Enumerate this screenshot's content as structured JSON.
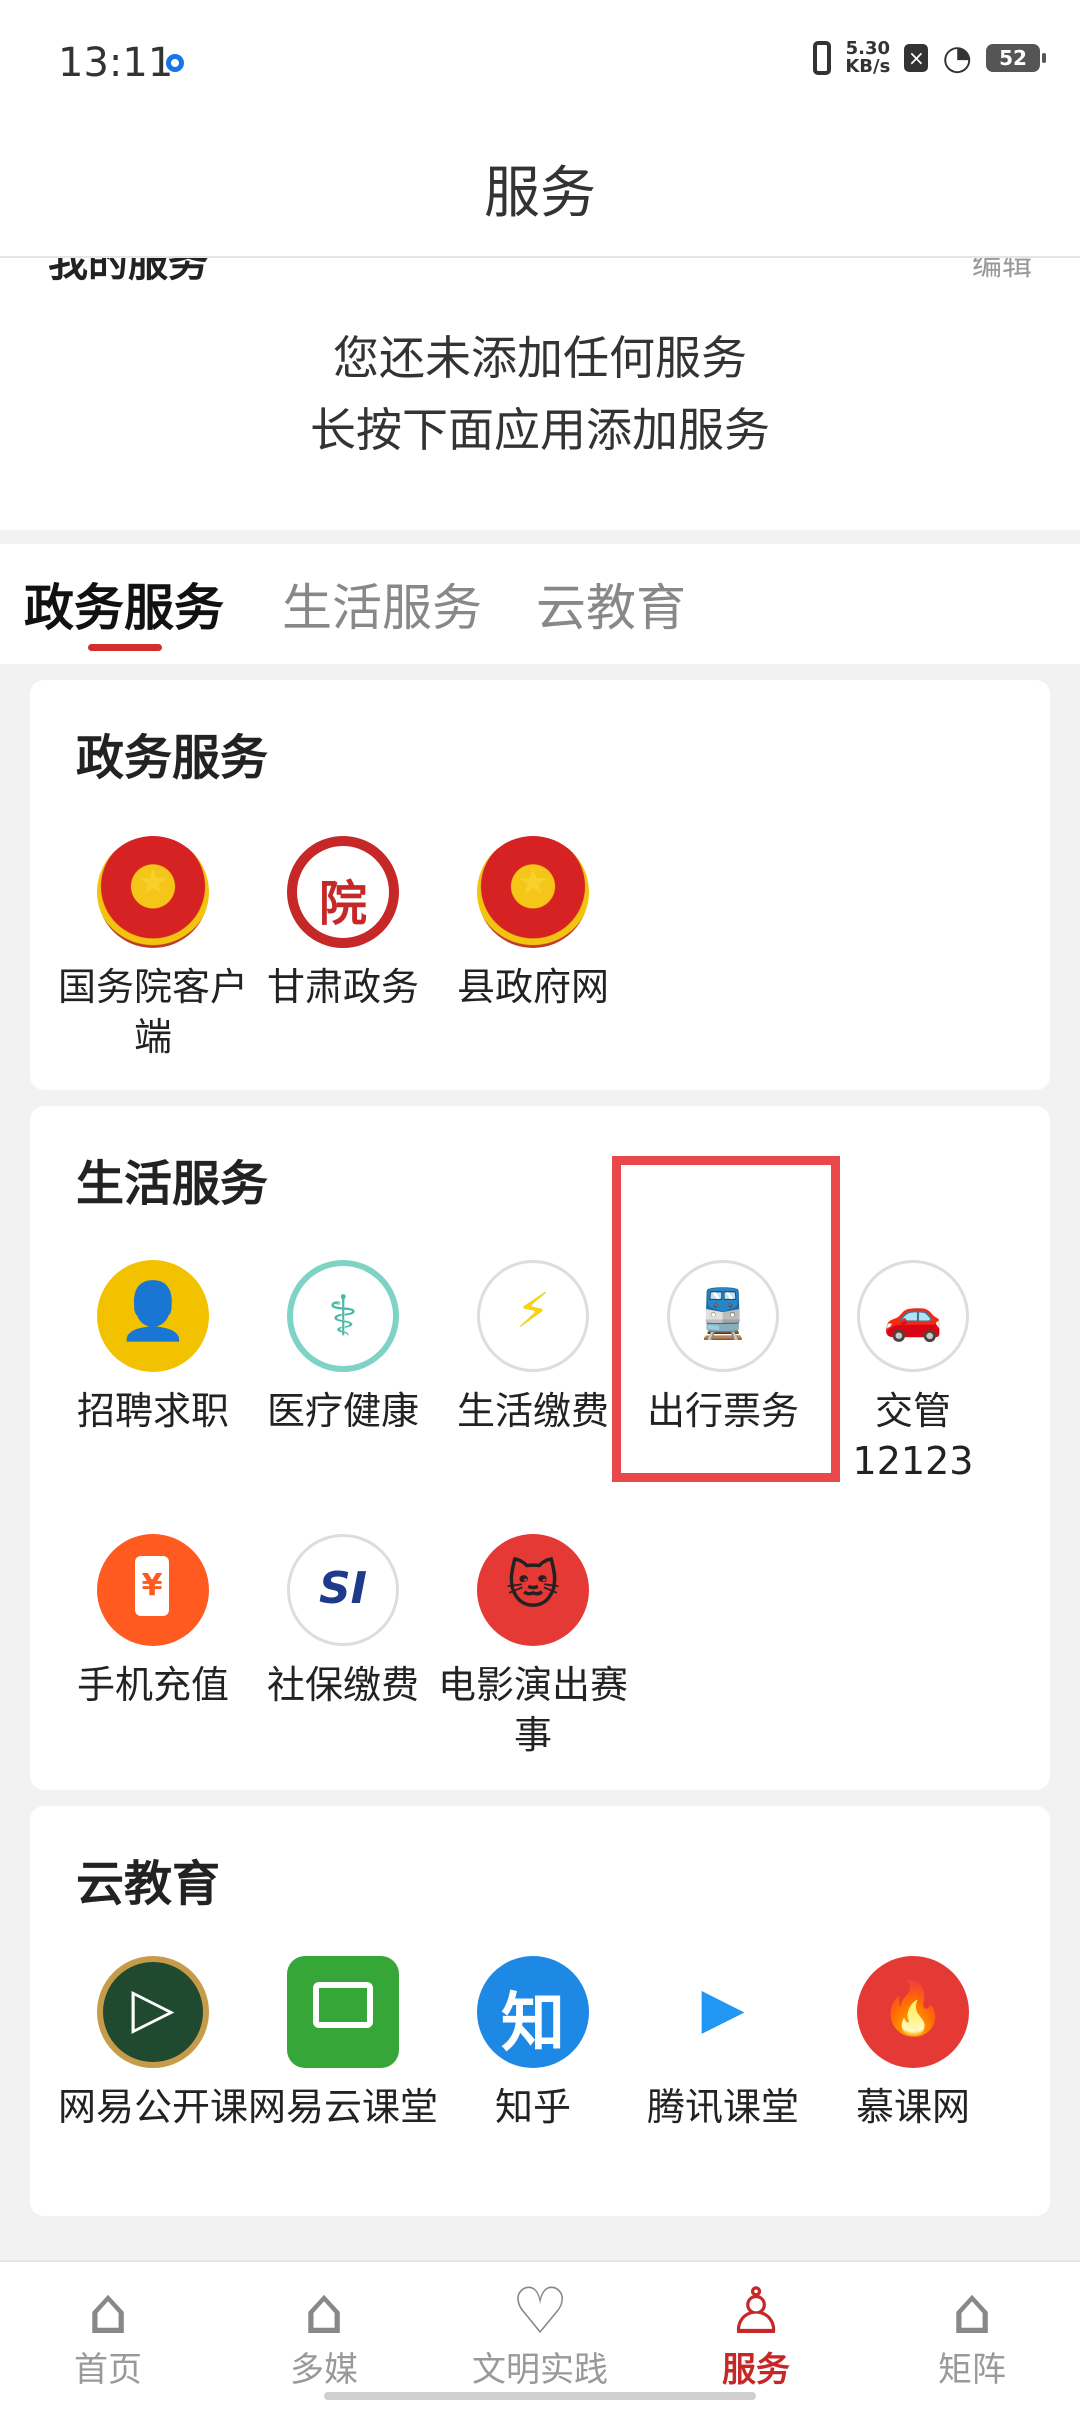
{
  "status_bar": {
    "time": "13:11",
    "speed": "5.30",
    "speed_unit": "KB/s",
    "battery": "52"
  },
  "header": {
    "title": "服务"
  },
  "my_services": {
    "title_partial": "我的服务",
    "right_partial": "编辑",
    "empty_line1": "您还未添加任何服务",
    "empty_line2": "长按下面应用添加服务"
  },
  "tabs": [
    {
      "label": "政务服务",
      "active": true
    },
    {
      "label": "生活服务",
      "active": false
    },
    {
      "label": "云教育",
      "active": false
    }
  ],
  "sections": {
    "gov": {
      "title": "政务服务",
      "apps": [
        {
          "label": "国务院客户端",
          "icon": "national-emblem-icon"
        },
        {
          "label": "甘肃政务",
          "icon": "court-seal-icon"
        },
        {
          "label": "县政府网",
          "icon": "national-emblem-icon"
        }
      ]
    },
    "life": {
      "title": "生活服务",
      "apps": [
        {
          "label": "招聘求职",
          "icon": "job-person-icon"
        },
        {
          "label": "医疗健康",
          "icon": "medical-icon"
        },
        {
          "label": "生活缴费",
          "icon": "water-bolt-icon"
        },
        {
          "label": "出行票务",
          "icon": "train-icon"
        },
        {
          "label": "交管12123",
          "icon": "car-icon"
        },
        {
          "label": "手机充值",
          "icon": "phone-recharge-icon"
        },
        {
          "label": "社保缴费",
          "icon": "social-security-icon"
        },
        {
          "label": "电影演出赛事",
          "icon": "cat-face-icon"
        }
      ]
    },
    "edu": {
      "title": "云教育",
      "apps": [
        {
          "label": "网易公开课",
          "icon": "chalkboard-play-icon"
        },
        {
          "label": "网易云课堂",
          "icon": "cloud-class-icon"
        },
        {
          "label": "知乎",
          "icon": "zhihu-icon"
        },
        {
          "label": "腾讯课堂",
          "icon": "tencent-class-icon"
        },
        {
          "label": "慕课网",
          "icon": "flame-icon"
        }
      ]
    }
  },
  "bottom_nav": [
    {
      "label": "首页",
      "icon": "home-icon"
    },
    {
      "label": "多媒",
      "icon": "house-outline-icon"
    },
    {
      "label": "文明实践",
      "icon": "heart-hand-icon"
    },
    {
      "label": "服务",
      "icon": "service-stamp-icon",
      "active": true
    },
    {
      "label": "矩阵",
      "icon": "house-outline-icon"
    }
  ],
  "colors": {
    "accent": "#c62828",
    "highlight": "#e8484a"
  }
}
